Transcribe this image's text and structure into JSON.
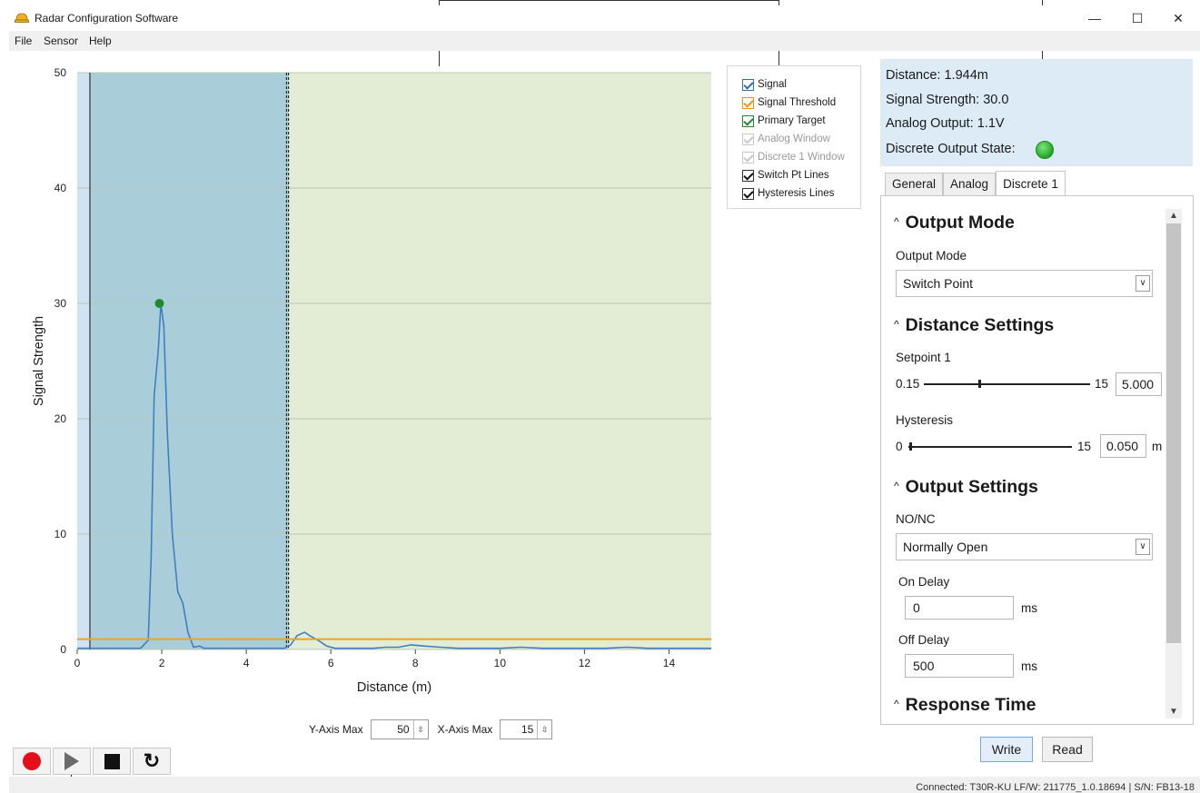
{
  "window": {
    "title": "Radar Configuration Software",
    "icon": "hard-hat-icon",
    "controls": {
      "minimize": "—",
      "maximize": "☐",
      "close": "✕"
    }
  },
  "menu": [
    "File",
    "Sensor",
    "Help"
  ],
  "chart_data": {
    "type": "line",
    "title": "",
    "xlabel": "Distance (m)",
    "ylabel": "Signal Strength",
    "xlim": [
      0,
      15
    ],
    "ylim": [
      0,
      50
    ],
    "x_ticks": [
      0,
      2,
      4,
      6,
      8,
      10,
      12,
      14
    ],
    "y_ticks": [
      0,
      10,
      20,
      30,
      40,
      50
    ],
    "grid": "horizontal",
    "series": [
      {
        "name": "Signal",
        "color": "#3f7fc4",
        "x": [
          0,
          0.5,
          1.0,
          1.5,
          1.68,
          1.75,
          1.82,
          1.92,
          1.98,
          2.05,
          2.13,
          2.25,
          2.38,
          2.5,
          2.62,
          2.75,
          2.9,
          3.0,
          3.2,
          3.5,
          4.0,
          4.5,
          4.9,
          5.05,
          5.2,
          5.38,
          5.5,
          5.7,
          5.9,
          6.1,
          6.4,
          6.8,
          7.0,
          7.3,
          7.6,
          7.9,
          8.2,
          8.6,
          9.0,
          9.5,
          10.0,
          10.5,
          11.0,
          11.5,
          12.0,
          12.5,
          13.0,
          13.5,
          14.0,
          14.5,
          15.0
        ],
        "y": [
          0.1,
          0.1,
          0.1,
          0.1,
          0.8,
          8,
          22,
          26,
          30,
          28,
          19,
          10,
          5,
          4,
          1.5,
          0.2,
          0.3,
          0.1,
          0.1,
          0.1,
          0.1,
          0.1,
          0.1,
          0.4,
          1.2,
          1.5,
          1.2,
          0.8,
          0.3,
          0.1,
          0.1,
          0.1,
          0.1,
          0.2,
          0.2,
          0.4,
          0.3,
          0.2,
          0.1,
          0.1,
          0.1,
          0.2,
          0.1,
          0.1,
          0.1,
          0.1,
          0.2,
          0.1,
          0.1,
          0.1,
          0.1
        ]
      },
      {
        "name": "Signal Threshold",
        "color": "#f0a21e",
        "x": [
          0,
          15
        ],
        "y": [
          0.9,
          0.9
        ]
      }
    ],
    "primary_target": {
      "x": 1.944,
      "y": 30.0,
      "color": "#1f8a34"
    },
    "regions": [
      {
        "name": "Discrete 1 Window",
        "x0": 0.3,
        "x1": 5.0,
        "color": "#a9ced9"
      },
      {
        "name": "Background",
        "x0": 5.0,
        "x1": 15.0,
        "color": "#e3edd6"
      }
    ],
    "switch_point_lines": [
      0.3,
      4.95,
      5.0
    ],
    "legend": "right"
  },
  "legend": [
    {
      "label": "Signal",
      "checked": true,
      "style": "blue"
    },
    {
      "label": "Signal Threshold",
      "checked": true,
      "style": "orange"
    },
    {
      "label": "Primary Target",
      "checked": true,
      "style": "green"
    },
    {
      "label": "Analog Window",
      "checked": true,
      "style": "grey"
    },
    {
      "label": "Discrete 1 Window",
      "checked": true,
      "style": "grey"
    },
    {
      "label": "Switch Pt Lines",
      "checked": true,
      "style": "black"
    },
    {
      "label": "Hysteresis Lines",
      "checked": true,
      "style": "black"
    }
  ],
  "axis_controls": {
    "y_label": "Y-Axis Max",
    "y_value": "50",
    "x_label": "X-Axis Max",
    "x_value": "15"
  },
  "playbar": [
    "record-icon",
    "play-icon",
    "stop-icon",
    "refresh-icon"
  ],
  "readout": {
    "distance": "Distance: 1.944m",
    "signal": "Signal Strength:  30.0",
    "analog": "Analog Output:  1.1V",
    "discrete_label": "Discrete Output State:",
    "discrete_state_color": "#23a623"
  },
  "tabs": [
    "General",
    "Analog",
    "Discrete 1"
  ],
  "active_tab": "Discrete 1",
  "panel": {
    "output_mode": {
      "header": "Output Mode",
      "label": "Output Mode",
      "value": "Switch Point"
    },
    "distance_settings": {
      "header": "Distance Settings",
      "setpoint_label": "Setpoint 1",
      "setpoint_min": "0.15",
      "setpoint_max": "15",
      "setpoint_value": "5.000",
      "setpoint_fraction": 0.33,
      "hysteresis_label": "Hysteresis",
      "hysteresis_min": "0",
      "hysteresis_max": "15",
      "hysteresis_value": "0.050",
      "hysteresis_unit": "m",
      "hysteresis_fraction": 0.003
    },
    "output_settings": {
      "header": "Output Settings",
      "nonc_label": "NO/NC",
      "nonc_value": "Normally Open",
      "on_delay_label": "On Delay",
      "on_delay_value": "0",
      "on_delay_unit": "ms",
      "off_delay_label": "Off Delay",
      "off_delay_value": "500",
      "off_delay_unit": "ms"
    },
    "response_time": {
      "header": "Response Time"
    }
  },
  "buttons": {
    "write": "Write",
    "read": "Read"
  },
  "status": "Connected: T30R-KU LF/W: 211775_1.0.18694 | S/N: FB13-18"
}
